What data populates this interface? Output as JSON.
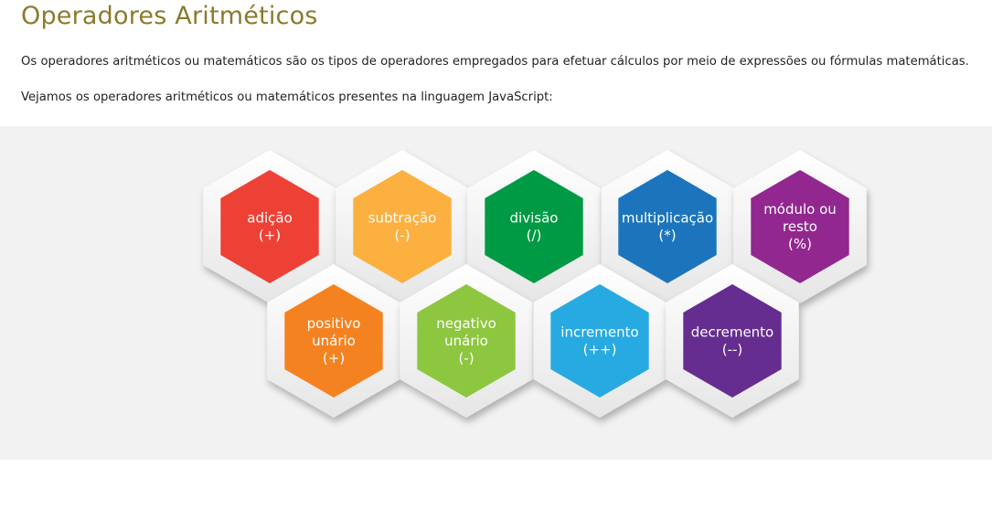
{
  "title": "Operadores Aritméticos",
  "intro": "Os operadores aritméticos ou matemáticos são os tipos de operadores empregados para efetuar cálculos por meio de expressões ou fórmulas matemáticas.",
  "lead": "Vejamos os operadores aritméticos ou matemáticos presentes na linguagem JavaScript:",
  "operators": [
    {
      "lines": [
        "adição",
        "(+)"
      ],
      "color": "#ee4136"
    },
    {
      "lines": [
        "subtração",
        "(-)"
      ],
      "color": "#fbb040"
    },
    {
      "lines": [
        "divisão",
        "(/)"
      ],
      "color": "#009a44"
    },
    {
      "lines": [
        "multiplicação",
        "(*)"
      ],
      "color": "#1c75bc"
    },
    {
      "lines": [
        "módulo ou",
        "resto",
        "(%)"
      ],
      "color": "#92278f"
    },
    {
      "lines": [
        "positivo",
        "unário",
        "(+)"
      ],
      "color": "#f58220"
    },
    {
      "lines": [
        "negativo",
        "unário",
        "(-)"
      ],
      "color": "#8dc63f"
    },
    {
      "lines": [
        "incremento",
        "(++)"
      ],
      "color": "#27aae1"
    },
    {
      "lines": [
        "decremento",
        "(--)"
      ],
      "color": "#662d91"
    }
  ]
}
